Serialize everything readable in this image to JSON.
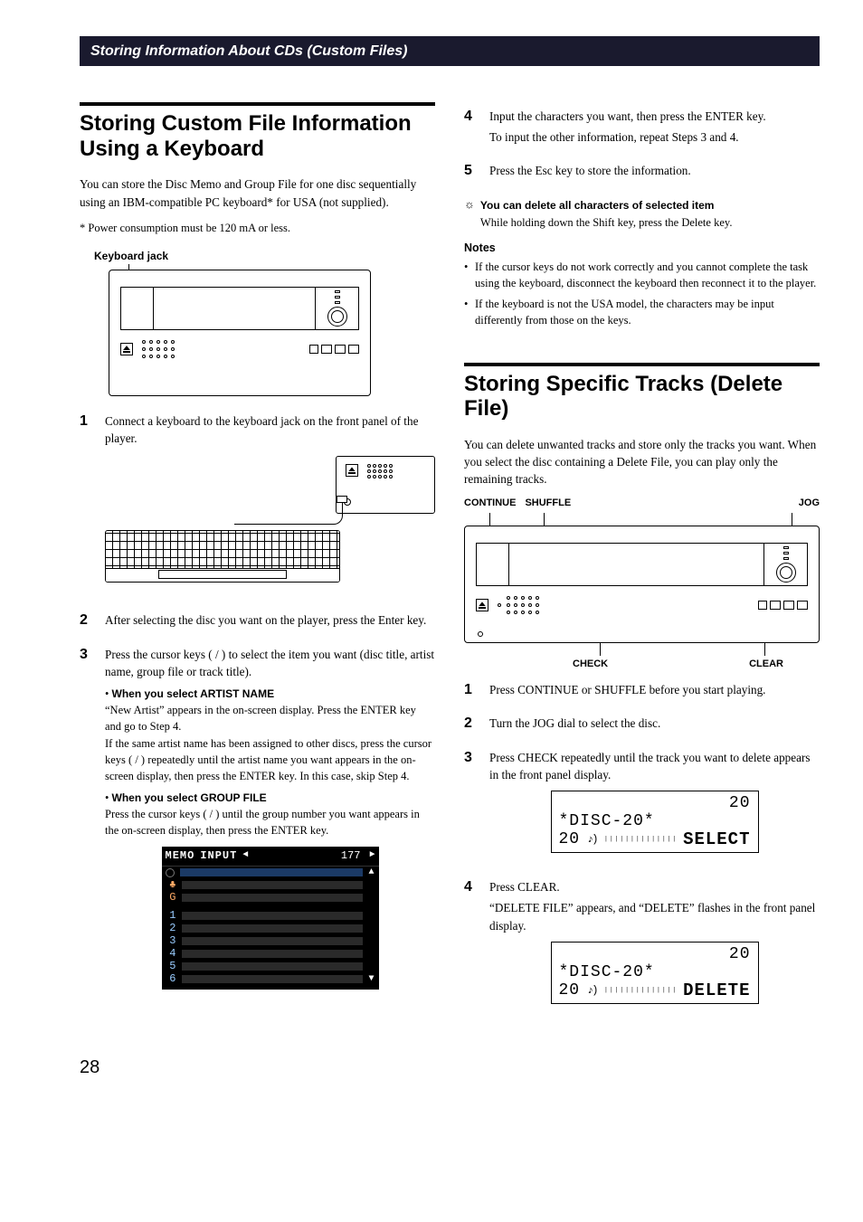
{
  "breadcrumb": "Storing Information About CDs (Custom Files)",
  "page_number": "28",
  "left": {
    "title": "Storing Custom File Information Using a Keyboard",
    "intro": "You can store the Disc Memo and Group File for one disc sequentially using an IBM-compatible PC keyboard* for USA (not supplied).",
    "footnote": "*  Power consumption must be 120 mA or less.",
    "kb_jack_label": "Keyboard jack",
    "steps": {
      "s1": "Connect a keyboard to the keyboard jack on the front panel of the player.",
      "s2": "After selecting the disc you want on the player, press the Enter key.",
      "s3": "Press the cursor keys (   /   ) to select the item you want (disc title, artist name, group file or track title).",
      "s3_sub1_title": "When you select ARTIST NAME",
      "s3_sub1_body1": "“New Artist” appears in the on-screen display. Press the ENTER key and go to Step 4.",
      "s3_sub1_body2": "If the same artist name has been assigned to other discs, press the cursor keys (    /    ) repeatedly until the artist name you want appears in the on-screen display, then press the ENTER key. In this case, skip Step 4.",
      "s3_sub2_title": "When you select GROUP FILE",
      "s3_sub2_body": "Press the cursor keys (    /    ) until the group number you want appears in the on-screen display, then press the ENTER key."
    },
    "osd": {
      "memo": "MEMO",
      "input": "INPUT",
      "num": "177",
      "rows_top": [
        "",
        "",
        ""
      ],
      "rows_num": [
        "1",
        "2",
        "3",
        "4",
        "5",
        "6"
      ]
    }
  },
  "right": {
    "steps": {
      "s4a": "Input the characters you want, then press the ENTER key.",
      "s4b": "To input the other information, repeat Steps 3 and 4.",
      "s5": "Press the Esc key to store the information."
    },
    "tip_title": "You can delete all characters of selected item",
    "tip_body": "While holding down the Shift key, press the Delete key.",
    "notes_h": "Notes",
    "notes": [
      "If the cursor keys do not work correctly and you cannot complete the task using the keyboard, disconnect the keyboard then reconnect it to the player.",
      "If the keyboard is not the USA model, the characters may be input differently from those on the keys."
    ],
    "section2_title": "Storing Specific Tracks (Delete File)",
    "section2_intro": "You can delete unwanted tracks and store only the tracks you want. When you select the disc containing a Delete File, you can play only the remaining tracks.",
    "annot": {
      "continue": "CONTINUE",
      "shuffle": "SHUFFLE",
      "jog": "JOG",
      "check": "CHECK",
      "clear": "CLEAR"
    },
    "steps2": {
      "s1": "Press CONTINUE or SHUFFLE before you start playing.",
      "s2": "Turn the JOG dial to select the disc.",
      "s3": "Press CHECK repeatedly until the track you want to delete appears in the front panel display.",
      "s4a": "Press CLEAR.",
      "s4b": "“DELETE FILE” appears, and “DELETE” flashes in the front panel display."
    },
    "lcd1": {
      "top": "20",
      "mid": "*DISC-20*",
      "bot_l": "20",
      "bot_r": "SELECT"
    },
    "lcd2": {
      "top": "20",
      "mid": "*DISC-20*",
      "bot_l": "20",
      "bot_r": "DELETE"
    }
  }
}
